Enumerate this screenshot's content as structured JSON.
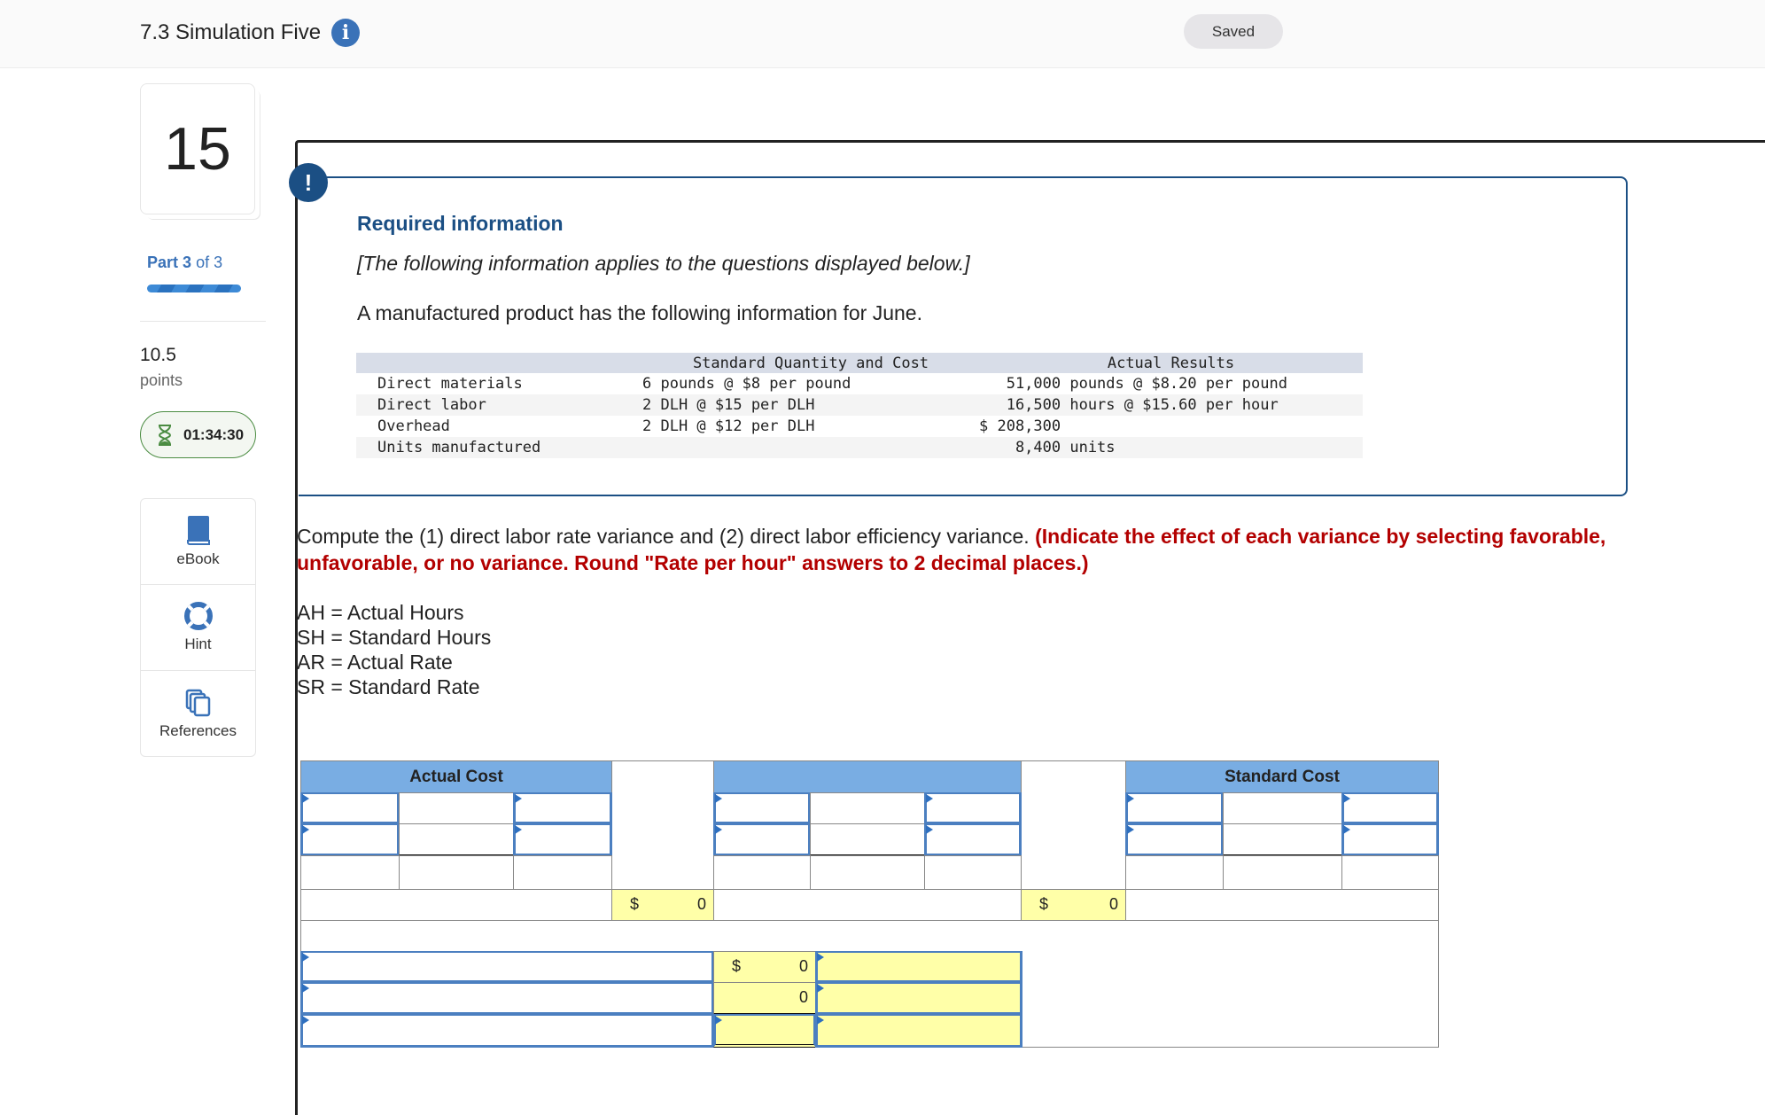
{
  "header": {
    "title": "7.3 Simulation Five",
    "info_icon": "info-icon",
    "saved_label": "Saved"
  },
  "sidebar": {
    "question_number": "15",
    "part_prefix": "Part",
    "part_current": "3",
    "part_suffix": "of 3",
    "part_progress_fraction": 1.0,
    "points_value": "10.5",
    "points_label": "points",
    "timer": "01:34:30",
    "tools": [
      {
        "label": "eBook",
        "icon": "book-icon"
      },
      {
        "label": "Hint",
        "icon": "lifebuoy-icon"
      },
      {
        "label": "References",
        "icon": "copy-pages-icon"
      }
    ]
  },
  "info": {
    "title": "Required information",
    "subtitle": "[The following information applies to the questions displayed below.]",
    "intro": "A manufactured product has the following information for June.",
    "table": {
      "headers": [
        "",
        "Standard Quantity and Cost",
        "Actual Results"
      ],
      "rows": [
        [
          "Direct materials",
          "6 pounds @ $8 per pound",
          "   51,000 pounds @ $8.20 per pound"
        ],
        [
          "Direct labor",
          "2 DLH @ $15 per DLH",
          "   16,500 hours @ $15.60 per hour"
        ],
        [
          "Overhead",
          "2 DLH @ $12 per DLH",
          "$ 208,300"
        ],
        [
          "Units manufactured",
          "",
          "    8,400 units"
        ]
      ]
    }
  },
  "question": {
    "text": "Compute the (1) direct labor rate variance and (2) direct labor efficiency variance. ",
    "instruction": "(Indicate the effect of each variance by selecting favorable, unfavorable, or no variance. Round \"Rate per hour\" answers to 2 decimal places.)",
    "legend": [
      "AH = Actual Hours",
      "SH = Standard Hours",
      "AR = Actual Rate",
      "SR = Standard Rate"
    ]
  },
  "worksheet": {
    "headers": {
      "actual": "Actual Cost",
      "middle": "",
      "standard": "Standard Cost"
    },
    "totals": {
      "actual_dollar": "$",
      "actual_value": "0",
      "middle_dollar": "$",
      "middle_value": "0"
    },
    "variances": [
      {
        "dollar": "$",
        "value": "0"
      },
      {
        "dollar": "",
        "value": "0"
      },
      {
        "dollar": "",
        "value": ""
      }
    ]
  },
  "colors": {
    "brand_blue": "#3a72b8",
    "navy": "#1b4f84",
    "header_blue": "#79ade3",
    "computed_yellow": "#ffffa8",
    "instruction_red": "#b30000",
    "timer_green": "#4b8c42"
  }
}
